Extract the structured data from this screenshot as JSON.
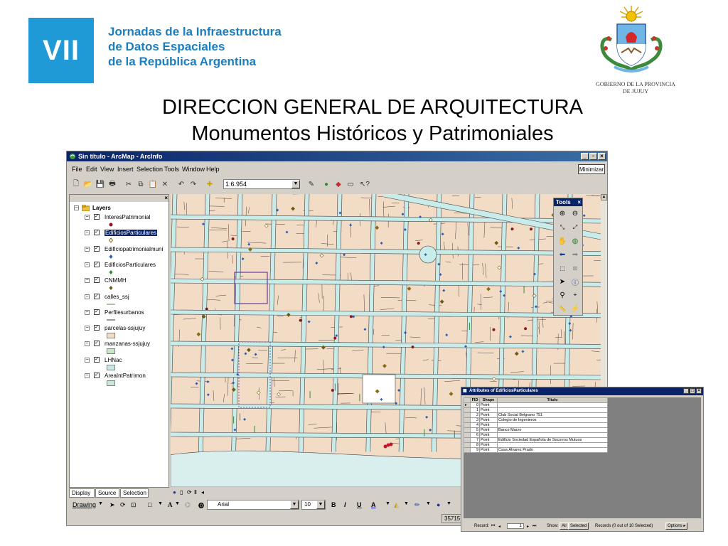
{
  "slide": {
    "badge": "VII",
    "conference_lines": [
      "Jornadas de la Infraestructura",
      "de Datos Espaciales",
      "de la República Argentina"
    ],
    "government_lines": [
      "GOBIERNO DE LA PROVINCIA",
      "DE JUJUY"
    ],
    "title": "DIRECCION GENERAL DE ARQUITECTURA",
    "subtitle": "Monumentos Históricos y Patrimoniales"
  },
  "app": {
    "window_title": "Sin título - ArcMap - ArcInfo",
    "menu": [
      "File",
      "Edit",
      "View",
      "Insert",
      "Selection",
      "Tools",
      "Window",
      "Help"
    ],
    "minimize_label": "Minimizar",
    "scale_value": "1:6.954",
    "toc": {
      "root": "Layers",
      "layers": [
        {
          "name": "InteresPatrimonial",
          "symbol": "dot",
          "color": "#8b1a1a"
        },
        {
          "name": "EdificiosParticulares",
          "symbol": "diamond-outline",
          "color": "#8b6914",
          "selected": true
        },
        {
          "name": "Edificiopatrimonialmuni",
          "symbol": "diamond",
          "color": "#2b5fb5"
        },
        {
          "name": "EdificiosParticulares",
          "symbol": "diamond",
          "color": "#2e8b2e"
        },
        {
          "name": "CNMMH",
          "symbol": "diamond",
          "color": "#6b5a10"
        },
        {
          "name": "calles_ssj",
          "symbol": "line",
          "color": "#5a8a5a"
        },
        {
          "name": "Perfilesurbanos",
          "symbol": "line",
          "color": "#333333"
        },
        {
          "name": "parcelas-ssjujuy",
          "symbol": "fill",
          "color": "#f3dcc6"
        },
        {
          "name": "manzanas-ssjujuy",
          "symbol": "fill",
          "color": "#c8e8c8"
        },
        {
          "name": "LHNac",
          "symbol": "fill",
          "color": "#c8e8e8"
        },
        {
          "name": "AreaIntPatrimon",
          "symbol": "fill",
          "color": "#c8e8d8"
        }
      ],
      "tabs": [
        "Display",
        "Source",
        "Selection"
      ]
    },
    "drawing": {
      "label": "Drawing",
      "font": "Arial",
      "font_size": "10",
      "bold": "B",
      "italic": "I",
      "underline": "U",
      "font_color_letter": "A"
    },
    "status_coord": "35715",
    "tools_title": "Tools",
    "map_colors": {
      "parcel": "#f3dcc6",
      "street": "#c8ecea",
      "edge": "#4a4040",
      "water": "#d8efee"
    }
  },
  "attributes": {
    "title": "Attributes of EdificiosParticulares",
    "columns": [
      "FID",
      "Shape",
      "Título"
    ],
    "rows": [
      [
        "0",
        "Point",
        ""
      ],
      [
        "1",
        "Point",
        ""
      ],
      [
        "2",
        "Point",
        "Club Social Belgrano 751"
      ],
      [
        "3",
        "Point",
        "Colegio de Ingenieros"
      ],
      [
        "4",
        "Point",
        ""
      ],
      [
        "5",
        "Point",
        "Banco Macro"
      ],
      [
        "6",
        "Point",
        ""
      ],
      [
        "7",
        "Point",
        "Edificio Sociedad Española de Socorros Mutuos"
      ],
      [
        "8",
        "Point",
        ""
      ],
      [
        "9",
        "Point",
        "Casa Álvarez Prado"
      ]
    ],
    "footer": {
      "record_label": "Record:",
      "record_value": "1",
      "show_label": "Show:",
      "all_label": "All",
      "selected_label": "Selected",
      "records_text": "Records (0 out of 10 Selected)",
      "options_label": "Options"
    }
  }
}
